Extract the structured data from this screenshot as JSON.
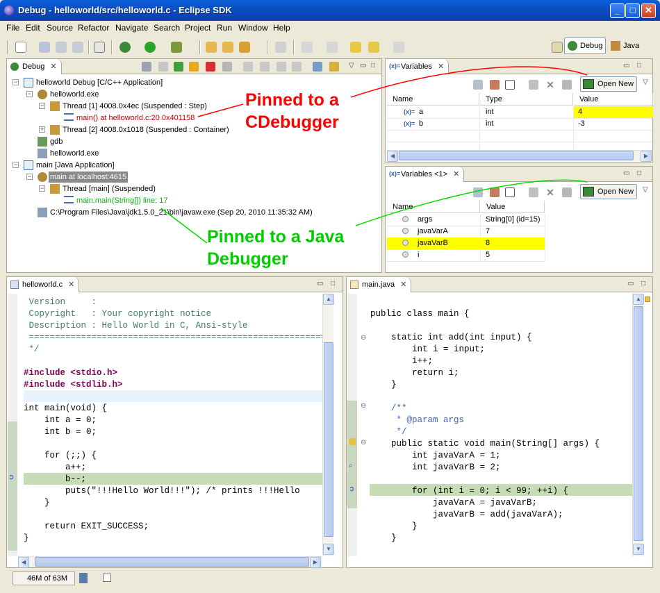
{
  "window": {
    "title": "Debug - helloworld/src/helloworld.c - Eclipse SDK",
    "minimize": "_",
    "maximize": "□",
    "close": "✕"
  },
  "menu": [
    "File",
    "Edit",
    "Source",
    "Refactor",
    "Navigate",
    "Search",
    "Project",
    "Run",
    "Window",
    "Help"
  ],
  "perspectives": {
    "debug": "Debug",
    "java": "Java"
  },
  "debug_view": {
    "tab": "Debug",
    "tree": [
      "helloworld Debug [C/C++ Application]",
      "helloworld.exe",
      "Thread [1] 4008.0x4ec (Suspended : Step)",
      "main() at helloworld.c:20 0x401158",
      "Thread [2] 4008.0x1018 (Suspended : Container)",
      "gdb",
      "helloworld.exe",
      "main [Java Application]",
      "main at localhost:4615",
      "Thread [main] (Suspended)",
      "main.main(String[]) line: 17",
      "C:\\Program Files\\Java\\jdk1.5.0_21\\bin\\javaw.exe (Sep 20, 2010 11:35:32 AM)"
    ]
  },
  "variables1": {
    "tab": "Variables",
    "open_new": "Open New",
    "headers": [
      "Name",
      "Type",
      "Value"
    ],
    "rows": [
      {
        "name": "a",
        "type": "int",
        "value": "4"
      },
      {
        "name": "b",
        "type": "int",
        "value": "-3"
      }
    ]
  },
  "variables2": {
    "tab": "Variables <1>",
    "open_new": "Open New",
    "headers": [
      "Name",
      "Value"
    ],
    "rows": [
      {
        "name": "args",
        "value": "String[0]  (id=15)"
      },
      {
        "name": "javaVarA",
        "value": "7"
      },
      {
        "name": "javaVarB",
        "value": "8"
      },
      {
        "name": "i",
        "value": "5"
      }
    ]
  },
  "annotations": {
    "c_label_1": "Pinned to a",
    "c_label_2": "CDebugger",
    "java_label_1": "Pinned to a Java",
    "java_label_2": "Debugger"
  },
  "editor_c": {
    "tab": "helloworld.c",
    "lines": [
      " Version     :",
      " Copyright   : Your copyright notice",
      " Description : Hello World in C, Ansi-style",
      " ============================================================",
      " */",
      "",
      "#include <stdio.h>",
      "#include <stdlib.h>",
      "",
      "int main(void) {",
      "    int a = 0;",
      "    int b = 0;",
      "",
      "    for (;;) {",
      "        a++;",
      "        b--;",
      "        puts(\"!!!Hello World!!!\"); /* prints !!!Hello",
      "    }",
      "",
      "    return EXIT_SUCCESS;",
      "}"
    ]
  },
  "editor_java": {
    "tab": "main.java",
    "lines": [
      "",
      "public class main {",
      "",
      "    static int add(int input) {",
      "        int i = input;",
      "        i++;",
      "        return i;",
      "    }",
      "",
      "    /**",
      "     * @param args",
      "     */",
      "    public static void main(String[] args) {",
      "        int javaVarA = 1;",
      "        int javaVarB = 2;",
      "",
      "        for (int i = 0; i < 99; ++i) {",
      "            javaVarA = javaVarB;",
      "            javaVarB = add(javaVarA);",
      "        }",
      "    }"
    ]
  },
  "status": {
    "heap": "46M of 63M"
  },
  "colors": {
    "highlight": "#ffff00",
    "current_line": "#c6dcb4",
    "c_annotation": "#ff0000",
    "java_annotation": "#00cc00"
  }
}
